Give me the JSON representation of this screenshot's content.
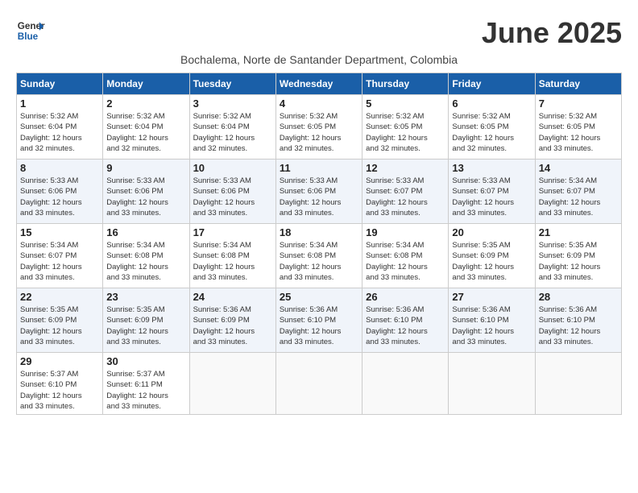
{
  "logo": {
    "line1": "General",
    "line2": "Blue"
  },
  "title": "June 2025",
  "subtitle": "Bochalema, Norte de Santander Department, Colombia",
  "days_of_week": [
    "Sunday",
    "Monday",
    "Tuesday",
    "Wednesday",
    "Thursday",
    "Friday",
    "Saturday"
  ],
  "weeks": [
    [
      {
        "day": "1",
        "info": "Sunrise: 5:32 AM\nSunset: 6:04 PM\nDaylight: 12 hours\nand 32 minutes."
      },
      {
        "day": "2",
        "info": "Sunrise: 5:32 AM\nSunset: 6:04 PM\nDaylight: 12 hours\nand 32 minutes."
      },
      {
        "day": "3",
        "info": "Sunrise: 5:32 AM\nSunset: 6:04 PM\nDaylight: 12 hours\nand 32 minutes."
      },
      {
        "day": "4",
        "info": "Sunrise: 5:32 AM\nSunset: 6:05 PM\nDaylight: 12 hours\nand 32 minutes."
      },
      {
        "day": "5",
        "info": "Sunrise: 5:32 AM\nSunset: 6:05 PM\nDaylight: 12 hours\nand 32 minutes."
      },
      {
        "day": "6",
        "info": "Sunrise: 5:32 AM\nSunset: 6:05 PM\nDaylight: 12 hours\nand 32 minutes."
      },
      {
        "day": "7",
        "info": "Sunrise: 5:32 AM\nSunset: 6:05 PM\nDaylight: 12 hours\nand 33 minutes."
      }
    ],
    [
      {
        "day": "8",
        "info": "Sunrise: 5:33 AM\nSunset: 6:06 PM\nDaylight: 12 hours\nand 33 minutes."
      },
      {
        "day": "9",
        "info": "Sunrise: 5:33 AM\nSunset: 6:06 PM\nDaylight: 12 hours\nand 33 minutes."
      },
      {
        "day": "10",
        "info": "Sunrise: 5:33 AM\nSunset: 6:06 PM\nDaylight: 12 hours\nand 33 minutes."
      },
      {
        "day": "11",
        "info": "Sunrise: 5:33 AM\nSunset: 6:06 PM\nDaylight: 12 hours\nand 33 minutes."
      },
      {
        "day": "12",
        "info": "Sunrise: 5:33 AM\nSunset: 6:07 PM\nDaylight: 12 hours\nand 33 minutes."
      },
      {
        "day": "13",
        "info": "Sunrise: 5:33 AM\nSunset: 6:07 PM\nDaylight: 12 hours\nand 33 minutes."
      },
      {
        "day": "14",
        "info": "Sunrise: 5:34 AM\nSunset: 6:07 PM\nDaylight: 12 hours\nand 33 minutes."
      }
    ],
    [
      {
        "day": "15",
        "info": "Sunrise: 5:34 AM\nSunset: 6:07 PM\nDaylight: 12 hours\nand 33 minutes."
      },
      {
        "day": "16",
        "info": "Sunrise: 5:34 AM\nSunset: 6:08 PM\nDaylight: 12 hours\nand 33 minutes."
      },
      {
        "day": "17",
        "info": "Sunrise: 5:34 AM\nSunset: 6:08 PM\nDaylight: 12 hours\nand 33 minutes."
      },
      {
        "day": "18",
        "info": "Sunrise: 5:34 AM\nSunset: 6:08 PM\nDaylight: 12 hours\nand 33 minutes."
      },
      {
        "day": "19",
        "info": "Sunrise: 5:34 AM\nSunset: 6:08 PM\nDaylight: 12 hours\nand 33 minutes."
      },
      {
        "day": "20",
        "info": "Sunrise: 5:35 AM\nSunset: 6:09 PM\nDaylight: 12 hours\nand 33 minutes."
      },
      {
        "day": "21",
        "info": "Sunrise: 5:35 AM\nSunset: 6:09 PM\nDaylight: 12 hours\nand 33 minutes."
      }
    ],
    [
      {
        "day": "22",
        "info": "Sunrise: 5:35 AM\nSunset: 6:09 PM\nDaylight: 12 hours\nand 33 minutes."
      },
      {
        "day": "23",
        "info": "Sunrise: 5:35 AM\nSunset: 6:09 PM\nDaylight: 12 hours\nand 33 minutes."
      },
      {
        "day": "24",
        "info": "Sunrise: 5:36 AM\nSunset: 6:09 PM\nDaylight: 12 hours\nand 33 minutes."
      },
      {
        "day": "25",
        "info": "Sunrise: 5:36 AM\nSunset: 6:10 PM\nDaylight: 12 hours\nand 33 minutes."
      },
      {
        "day": "26",
        "info": "Sunrise: 5:36 AM\nSunset: 6:10 PM\nDaylight: 12 hours\nand 33 minutes."
      },
      {
        "day": "27",
        "info": "Sunrise: 5:36 AM\nSunset: 6:10 PM\nDaylight: 12 hours\nand 33 minutes."
      },
      {
        "day": "28",
        "info": "Sunrise: 5:36 AM\nSunset: 6:10 PM\nDaylight: 12 hours\nand 33 minutes."
      }
    ],
    [
      {
        "day": "29",
        "info": "Sunrise: 5:37 AM\nSunset: 6:10 PM\nDaylight: 12 hours\nand 33 minutes."
      },
      {
        "day": "30",
        "info": "Sunrise: 5:37 AM\nSunset: 6:11 PM\nDaylight: 12 hours\nand 33 minutes."
      },
      {
        "day": "",
        "info": ""
      },
      {
        "day": "",
        "info": ""
      },
      {
        "day": "",
        "info": ""
      },
      {
        "day": "",
        "info": ""
      },
      {
        "day": "",
        "info": ""
      }
    ]
  ]
}
